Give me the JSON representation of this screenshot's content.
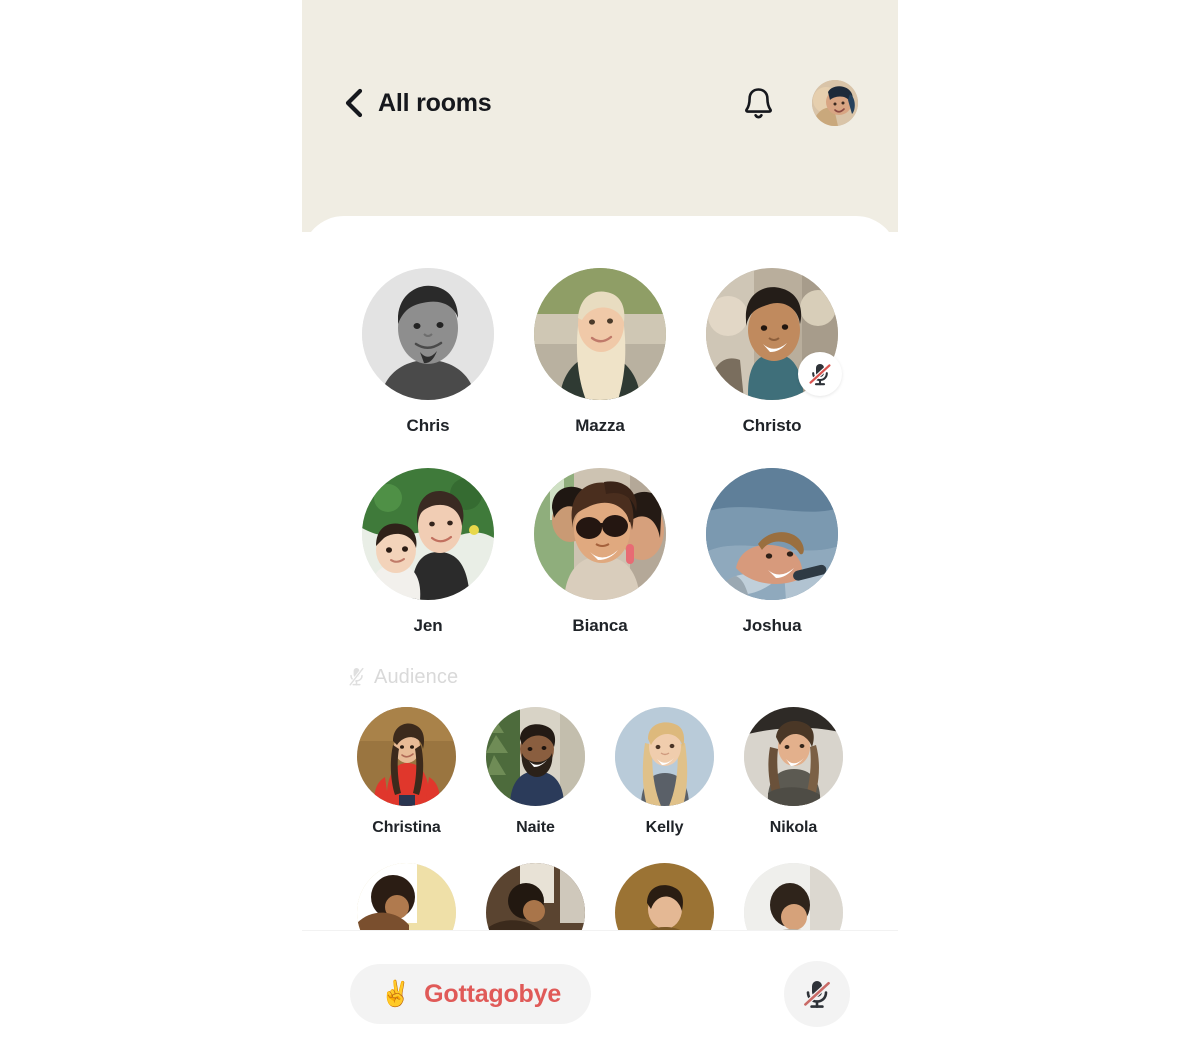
{
  "theme": {
    "header_bg": "#F0EDE3",
    "sheet_bg": "#FFFFFF",
    "text_primary": "#1F2328",
    "audience_label_color": "#D9D9D9",
    "leave_text_color": "#E05A58",
    "pill_bg": "#F3F3F3",
    "mute_slash_color": "#D9534F"
  },
  "header": {
    "back_icon": "chevron-left-icon",
    "title": "All rooms",
    "bell_icon": "bell-icon",
    "avatar_icon": "user-avatar",
    "avatar_alt": "Your profile"
  },
  "stage": {
    "speakers": [
      {
        "name": "Chris",
        "muted": false,
        "avatar_alt": "Chris"
      },
      {
        "name": "Mazza",
        "muted": false,
        "avatar_alt": "Mazza"
      },
      {
        "name": "Christo",
        "muted": true,
        "avatar_alt": "Christo"
      },
      {
        "name": "Jen",
        "muted": false,
        "avatar_alt": "Jen"
      },
      {
        "name": "Bianca",
        "muted": false,
        "avatar_alt": "Bianca"
      },
      {
        "name": "Joshua",
        "muted": false,
        "avatar_alt": "Joshua"
      }
    ]
  },
  "audience": {
    "icon": "mic-off-icon",
    "label": "Audience",
    "members": [
      {
        "name": "Christina",
        "avatar_alt": "Christina"
      },
      {
        "name": "Naite",
        "avatar_alt": "Naite"
      },
      {
        "name": "Kelly",
        "avatar_alt": "Kelly"
      },
      {
        "name": "Nikola",
        "avatar_alt": "Nikola"
      }
    ],
    "partial_row_count": 4
  },
  "bottom_bar": {
    "leave_emoji": "✌️",
    "leave_label": "Gottagobye",
    "mic_icon": "mic-off-icon",
    "mic_state": "muted"
  }
}
